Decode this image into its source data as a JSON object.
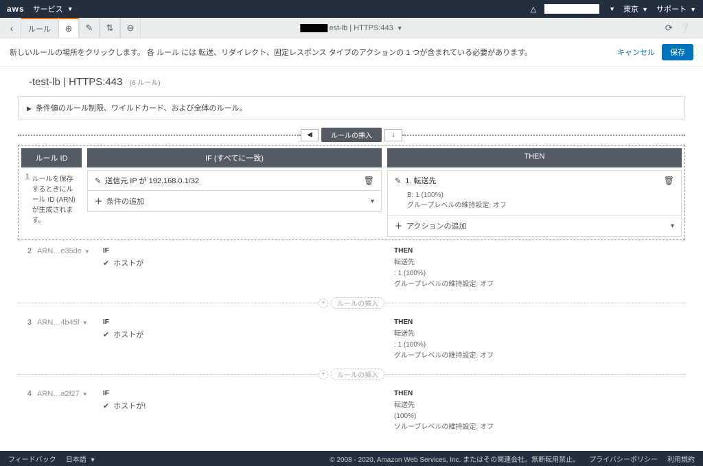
{
  "topnav": {
    "logo": "aws",
    "services": "サービス",
    "region": "東京",
    "support": "サポート"
  },
  "tabbar": {
    "rules": "ルール",
    "center_suffix": "est-lb",
    "center_proto": "HTTPS:443"
  },
  "hint": {
    "text": "新しいルールの場所をクリックします。 各 ルール には 転送、リダイレクト、固定レスポンス タイプのアクションの 1 つが含まれている必要があります。",
    "cancel": "キャンセル",
    "save": "保存"
  },
  "page": {
    "title": "-test-lb | HTTPS:443",
    "count": "(6 ルール)",
    "expander": "条件値のルール制限、ワイルドカード、および全体のルール。"
  },
  "insert": {
    "label": "ルールの挿入",
    "down": "↓"
  },
  "headers": {
    "id": "ルール ID",
    "if": "IF (すべてに一致)",
    "then": "THEN"
  },
  "editRule": {
    "num": "1",
    "idNote": "ルールを保存するときにルール ID (ARN) が生成されます。",
    "cond": "送信元 IP が 192.168.0.1/32",
    "addCond": "条件の追加",
    "then1": "1. 転送先",
    "thenSub1": "B: 1 (100%)",
    "thenSub2": "グループレベルの維持設定: オフ",
    "addAction": "アクションの追加"
  },
  "rules": [
    {
      "num": "2",
      "arn": "ARN…e35de",
      "ifLabel": "IF",
      "ifText": "ホストが",
      "thenLabel": "THEN",
      "thenHead": "転送先",
      "thenSub1": ": 1 (100%)",
      "thenSub2": "グループレベルの維持設定: オフ"
    },
    {
      "num": "3",
      "arn": "ARN…4b45f",
      "ifLabel": "IF",
      "ifText": "ホストが",
      "thenLabel": "THEN",
      "thenHead": "転送先",
      "thenSub1": ": 1 (100%)",
      "thenSub2": "グループレベルの維持設定: オフ"
    },
    {
      "num": "4",
      "arn": "ARN…a2f27",
      "ifLabel": "IF",
      "ifText": "ホストが!",
      "thenLabel": "THEN",
      "thenHead": "転送先",
      "thenSub1": "(100%)",
      "thenSub2": "ソルーブレベルの維持設定: オフ"
    }
  ],
  "insertMid": "ルールの挿入",
  "footer": {
    "feedback": "フィードバック",
    "lang": "日本語",
    "copy": "© 2008 - 2020, Amazon Web Services, Inc. またはその関連会社。無断転用禁止。",
    "privacy": "プライバシーポリシー",
    "terms": "利用規約"
  }
}
